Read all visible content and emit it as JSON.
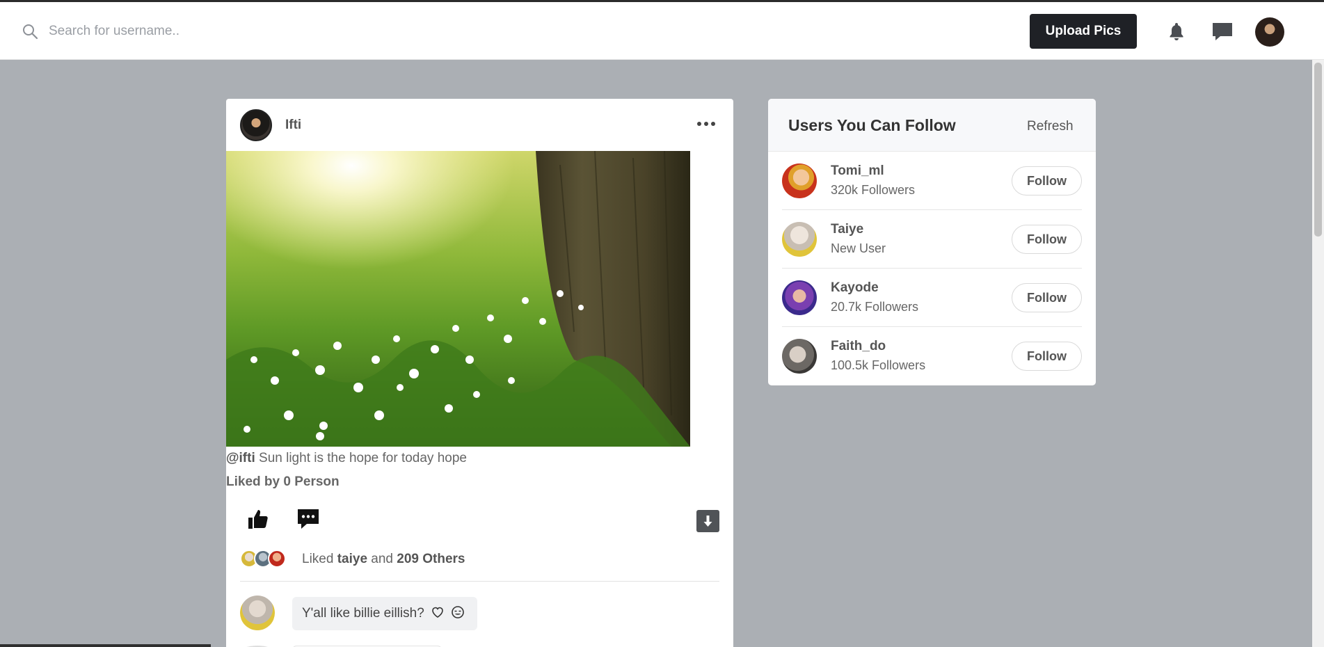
{
  "header": {
    "search_placeholder": "Search for username..",
    "upload_label": "Upload Pics",
    "icons": [
      "search-icon",
      "bell-icon",
      "chat-icon",
      "profile-avatar"
    ]
  },
  "post": {
    "username": "Ifti",
    "caption_handle": "@ifti",
    "caption_text": "Sun light is the hope for today hope",
    "liked_by_prefix": "Liked by",
    "liked_by_count": "0 Person",
    "liked_summary": {
      "prefix": "Liked",
      "user": "taiye",
      "conjunction": "and",
      "others": "209 Others"
    },
    "comment": {
      "text": "Y'all like billie eillish?"
    }
  },
  "suggestions": {
    "title": "Users You Can Follow",
    "refresh_label": "Refresh",
    "follow_label": "Follow",
    "users": [
      {
        "name": "Tomi_ml",
        "meta": "320k Followers"
      },
      {
        "name": "Taiye",
        "meta": "New User"
      },
      {
        "name": "Kayode",
        "meta": "20.7k Followers"
      },
      {
        "name": "Faith_do",
        "meta": "100.5k Followers"
      }
    ]
  },
  "colors": {
    "page_bg": "#abafb4",
    "button_dark": "#1f2126",
    "card_bg": "#ffffff"
  }
}
